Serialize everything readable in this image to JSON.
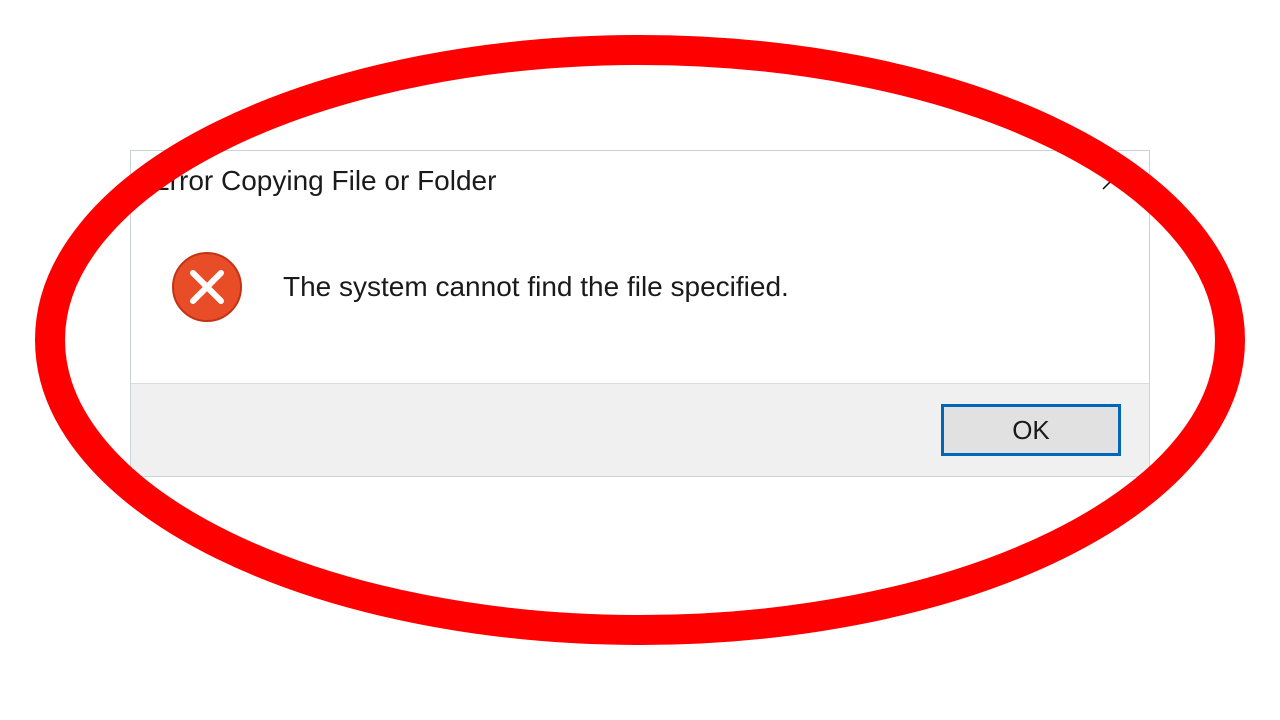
{
  "dialog": {
    "title": "Error Copying File or Folder",
    "message": "The system cannot find the file specified.",
    "ok_label": "OK"
  },
  "colors": {
    "error_icon_bg": "#e84d28",
    "button_focus_border": "#0067b8",
    "annotation_stroke": "#ff0000"
  }
}
